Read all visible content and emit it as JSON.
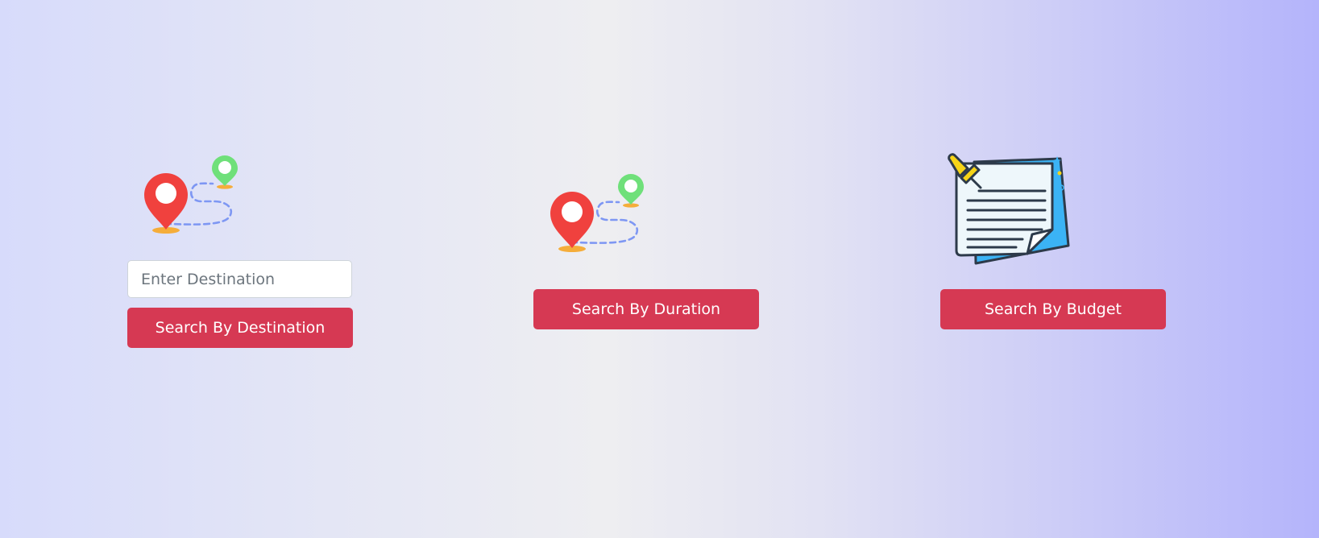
{
  "destination": {
    "icon": "route-map-pins-icon",
    "input_placeholder": "Enter Destination",
    "input_value": "",
    "button_label": "Search By Destination"
  },
  "duration": {
    "icon": "route-map-pins-icon",
    "button_label": "Search By Duration"
  },
  "budget": {
    "icon": "notepad-pin-icon",
    "button_label": "Search By Budget"
  },
  "colors": {
    "button_bg": "#d63953",
    "button_text": "#ffffff",
    "pin_red": "#f0413e",
    "pin_green": "#6fe07a",
    "path_blue": "#7e97f3",
    "note_blue": "#3bb3f5",
    "pushpin_yellow": "#f6d418"
  }
}
